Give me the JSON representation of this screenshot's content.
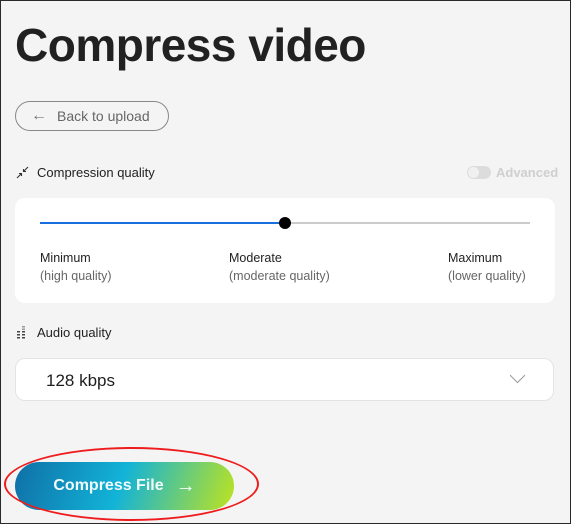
{
  "page": {
    "title": "Compress video",
    "back_button": {
      "icon": "arrow-left-icon",
      "label": "Back to upload"
    }
  },
  "compression": {
    "label": "Compression quality",
    "icon": "compress-arrows-icon",
    "advanced_toggle": {
      "label": "Advanced",
      "enabled": false
    },
    "slider": {
      "value_fraction": 0.5,
      "selected": "Moderate",
      "fill_color": "#1a6fe0",
      "ticks": [
        {
          "title": "Minimum",
          "subtitle": "(high quality)"
        },
        {
          "title": "Moderate",
          "subtitle": "(moderate quality)"
        },
        {
          "title": "Maximum",
          "subtitle": "(lower quality)"
        }
      ]
    }
  },
  "audio": {
    "label": "Audio quality",
    "icon": "audio-bars-icon",
    "selected": "128 kbps"
  },
  "cta": {
    "label": "Compress File",
    "icon": "arrow-right-icon"
  },
  "annotation": {
    "color": "#ee1c1c",
    "shape": "ellipse-around-compress-button"
  }
}
